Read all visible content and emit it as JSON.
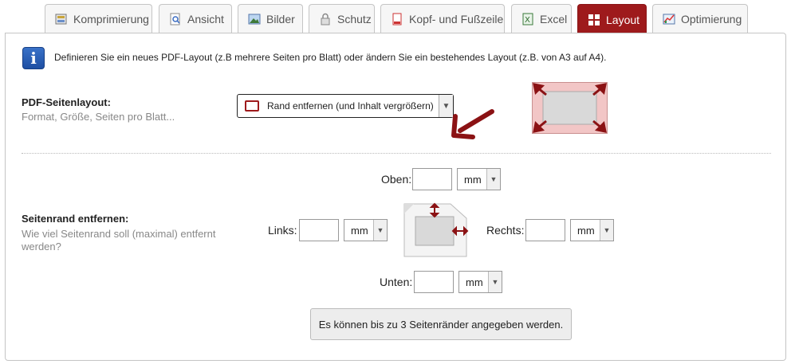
{
  "tabs": [
    {
      "label": "Komprimierung",
      "icon": "compress-icon",
      "active": false
    },
    {
      "label": "Ansicht",
      "icon": "magnifier-page-icon",
      "active": false
    },
    {
      "label": "Bilder",
      "icon": "image-icon",
      "active": false
    },
    {
      "label": "Schutz",
      "icon": "lock-icon",
      "active": false
    },
    {
      "label": "Kopf- und Fußzeile",
      "icon": "pdf-header-icon",
      "active": false
    },
    {
      "label": "Excel",
      "icon": "excel-icon",
      "active": false
    },
    {
      "label": "Layout",
      "icon": "layout-grid-icon",
      "active": true
    },
    {
      "label": "Optimierung",
      "icon": "chart-icon",
      "active": false
    }
  ],
  "info": {
    "icon": "i",
    "text": "Definieren Sie ein neues PDF-Layout (z.B mehrere Seiten pro Blatt) oder ändern Sie ein bestehendes Layout (z.B. von A3 auf A4)."
  },
  "layout_section": {
    "title": "PDF-Seitenlayout:",
    "subtitle": "Format, Größe, Seiten pro Blatt...",
    "selected": "Rand entfernen (und Inhalt vergrößern)"
  },
  "margin_section": {
    "title": "Seitenrand entfernen:",
    "subtitle_line1": "Wie viel Seitenrand soll (maximal) entfernt",
    "subtitle_line2": "werden?",
    "top_label": "Oben:",
    "left_label": "Links:",
    "right_label": "Rechts:",
    "bottom_label": "Unten:",
    "top_value": "",
    "left_value": "",
    "right_value": "",
    "bottom_value": "",
    "unit": "mm"
  },
  "button": {
    "label": "Es können bis zu 3 Seitenränder angegeben werden."
  },
  "colors": {
    "accent": "#9e1a1c",
    "arrow": "#8b1214",
    "preview_bg": "#f2c6c6"
  }
}
